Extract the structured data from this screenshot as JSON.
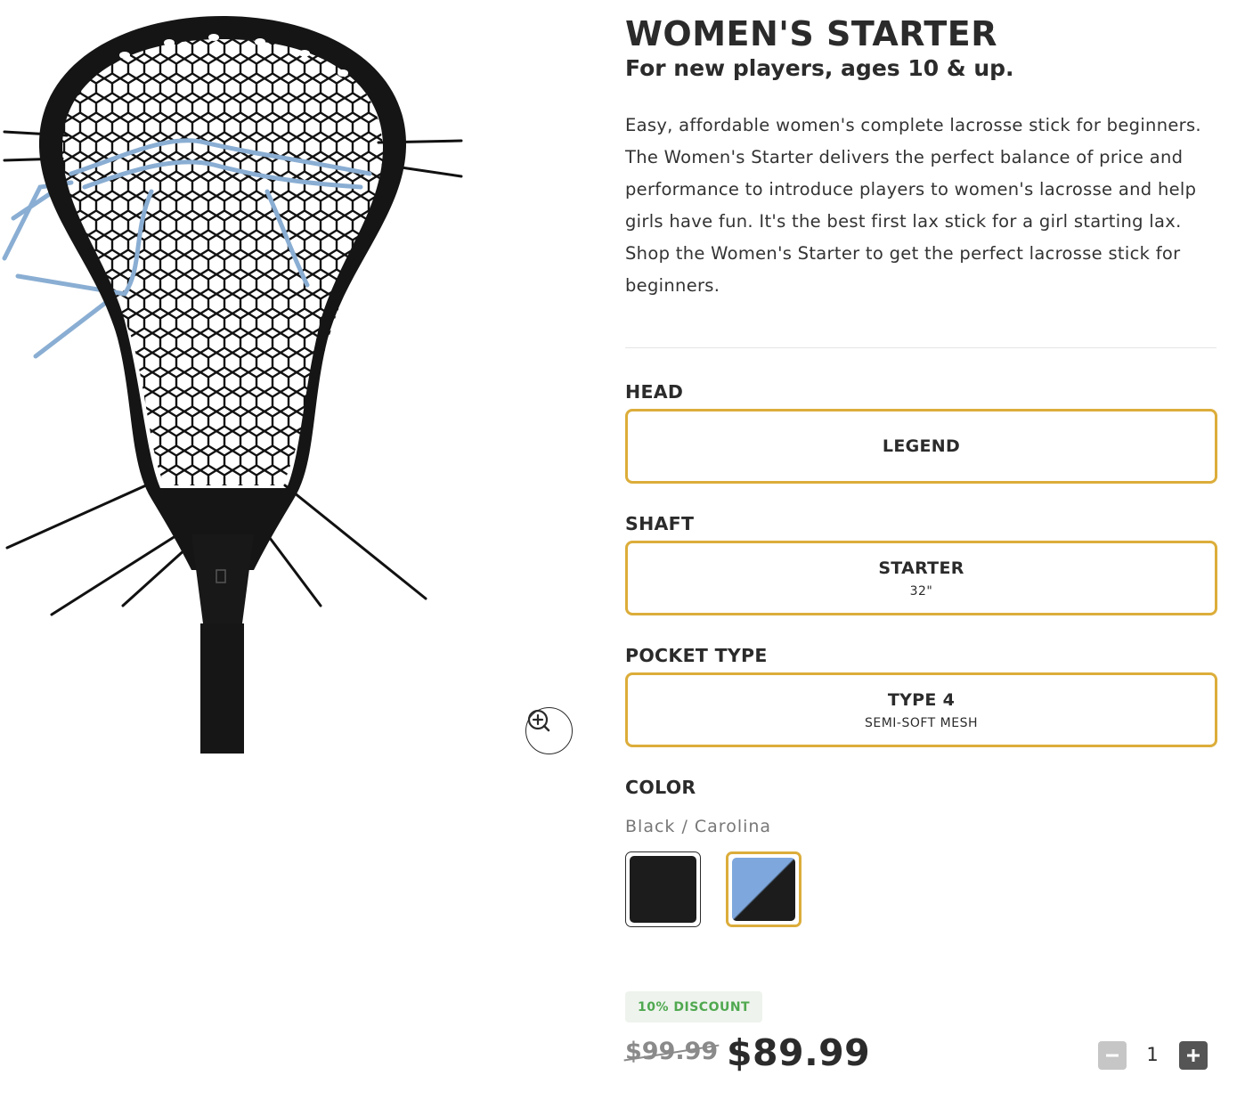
{
  "product": {
    "title": "WOMEN'S STARTER",
    "subtitle": "For new players, ages 10 & up.",
    "description": "Easy, affordable women's complete lacrosse stick for beginners. The Women's Starter delivers the perfect balance of price and performance to introduce players to women's lacrosse and help girls have fun. It's the best first lax stick for a girl starting lax. Shop the Women's Starter to get the perfect lacrosse stick for beginners."
  },
  "media": {
    "zoom_icon": "zoom-in-icon",
    "image": "lacrosse-stick-head-image"
  },
  "options": {
    "head": {
      "label": "HEAD",
      "value": "LEGEND"
    },
    "shaft": {
      "label": "SHAFT",
      "value": "STARTER",
      "detail": "32\""
    },
    "pocket": {
      "label": "POCKET TYPE",
      "value": "TYPE 4",
      "detail": "SEMI-SOFT MESH"
    },
    "color": {
      "label": "COLOR",
      "selected_name": "Black / Carolina",
      "swatches": [
        {
          "name": "Black",
          "colors": [
            "#1c1c1c"
          ]
        },
        {
          "name": "Black / Carolina",
          "colors": [
            "#7da7dd",
            "#1c1c1c"
          ],
          "selected": true
        }
      ]
    }
  },
  "pricing": {
    "discount_badge": "10% DISCOUNT",
    "original_price": "$99.99",
    "sale_price": "$89.99"
  },
  "quantity": {
    "value": "1",
    "minus_icon": "minus-icon",
    "plus_icon": "plus-icon"
  },
  "colors": {
    "accent": "#dcad3a",
    "discount_green": "#4fa84f",
    "text": "#2b2b2b"
  }
}
